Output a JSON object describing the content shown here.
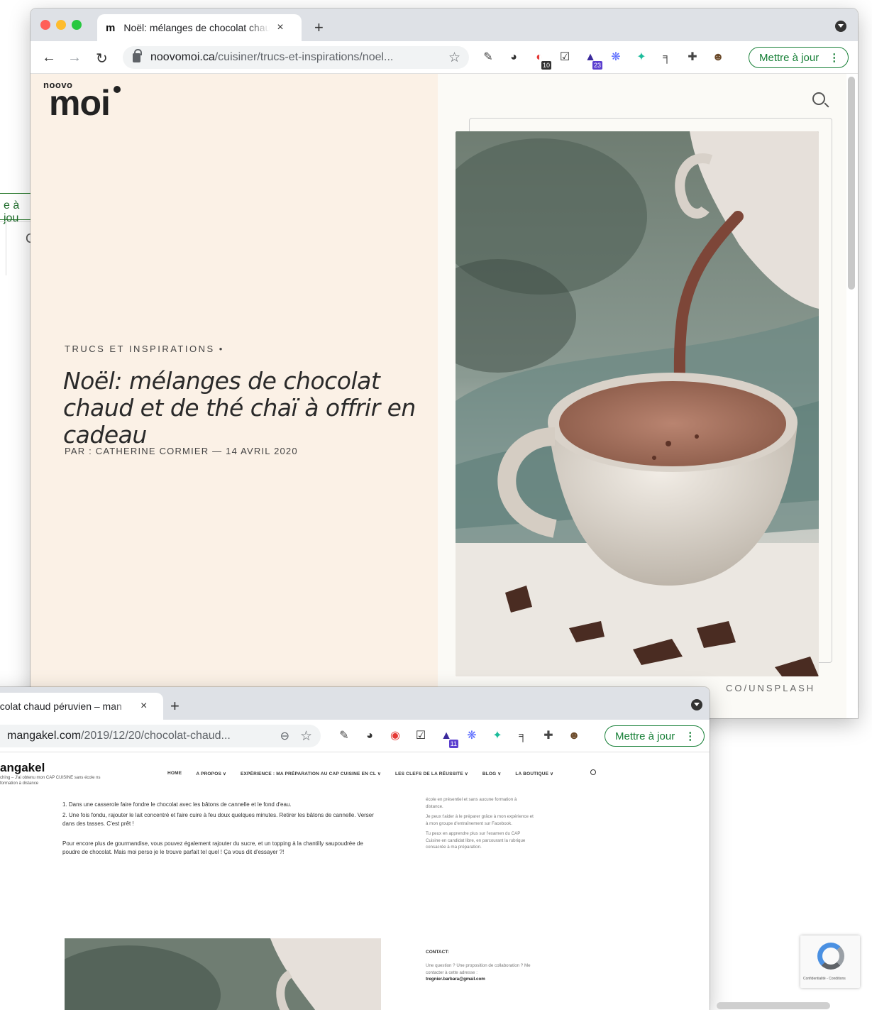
{
  "background_window": {
    "update_label_fragment": "e à jou",
    "glyph": "C"
  },
  "window1": {
    "tab": {
      "favicon": "m",
      "title": "Noël: mélanges de chocolat chaud",
      "close": "×"
    },
    "new_tab": "+",
    "address": {
      "host": "noovomoi.ca",
      "path": "/cuisiner/trucs-et-inspirations/noel..."
    },
    "extensions": [
      {
        "icon": "eyedropper-icon",
        "badge": ""
      },
      {
        "icon": "glasses-icon",
        "badge": ""
      },
      {
        "icon": "magnet-icon",
        "badge": "10"
      },
      {
        "icon": "checkbox-icon",
        "badge": ""
      },
      {
        "icon": "graduation-cap-icon",
        "badge": "23"
      },
      {
        "icon": "snowflake-icon",
        "badge": ""
      },
      {
        "icon": "runner-icon",
        "badge": ""
      },
      {
        "icon": "pipe-icon",
        "badge": ""
      },
      {
        "icon": "puzzle-icon",
        "badge": ""
      },
      {
        "icon": "avatar-icon",
        "badge": ""
      }
    ],
    "update_button": "Mettre à jour",
    "page": {
      "logo_small": "noovo",
      "logo_big": "moi",
      "kicker": "TRUCS ET INSPIRATIONS •",
      "headline": "Noël: mélanges de chocolat chaud et de thé chaï à offrir en cadeau",
      "byline": "PAR : CATHERINE CORMIER — 14 AVRIL 2020",
      "photo_credit": "CO/UNSPLASH"
    }
  },
  "window2": {
    "tab": {
      "title": "ocolat chaud péruvien – man",
      "close": "×"
    },
    "new_tab": "+",
    "address": {
      "host": "mangakel.com",
      "path": "/2019/12/20/chocolat-chaud..."
    },
    "extensions": [
      {
        "icon": "eyedropper-icon",
        "badge": ""
      },
      {
        "icon": "glasses-icon",
        "badge": ""
      },
      {
        "icon": "opera-icon",
        "badge": ""
      },
      {
        "icon": "checkbox-icon",
        "badge": ""
      },
      {
        "icon": "graduation-cap-icon",
        "badge": "11"
      },
      {
        "icon": "snowflake-icon",
        "badge": ""
      },
      {
        "icon": "runner-icon",
        "badge": ""
      },
      {
        "icon": "pipe-icon",
        "badge": ""
      },
      {
        "icon": "puzzle-icon",
        "badge": ""
      },
      {
        "icon": "avatar-icon",
        "badge": ""
      }
    ],
    "update_button": "Mettre à jour",
    "page": {
      "logo": "angakel",
      "tagline": "ching – J'ai obtenu mon CAP CUISINE sans école ns formation à distance",
      "nav": [
        "HOME",
        "A PROPOS ∨",
        "EXPÉRIENCE : MA PRÉPARATION AU CAP CUISINE EN CL ∨",
        "LES CLEFS DE LA RÉUSSITE ∨",
        "BLOG ∨",
        "LA BOUTIQUE ∨"
      ],
      "steps": [
        "1. Dans une casserole faire fondre le chocolat avec les bâtons de cannelle et le fond d'eau.",
        "2. Une fois fondu, rajouter le lait concentré et faire cuire à feu doux quelques minutes. Retirer les bâtons de cannelle. Verser dans des tasses. C'est prêt !"
      ],
      "paragraph": "Pour encore plus de gourmandise, vous pouvez également rajouter du sucre, et un topping à la chantilly saupoudrée de poudre de chocolat. Mais moi perso je le trouve parfait tel quel ! Ça vous dit d'essayer ?!",
      "sidebar": [
        "école en présentiel et sans aucune formation à distance.",
        "Je peux t'aider à le préparer grâce à mon expérience et à mon groupe d'entraînement sur Facebook.",
        "Tu peux en apprendre plus sur l'examen du CAP Cuisine en candidat libre, en parcourant la rubrique consacrée à ma préparation."
      ],
      "contact_heading": "CONTACT:",
      "contact_text": "Une question ? Une proposition de collaboration ? Me contacter à cette adresse :",
      "contact_email": "tregnier.barbara@gmail.com",
      "recaptcha_text": "Confidentialité - Conditions"
    }
  },
  "colors": {
    "hero_bg": "#fbf1e6",
    "update_green": "#188038",
    "tab_strip": "#dee1e6"
  }
}
